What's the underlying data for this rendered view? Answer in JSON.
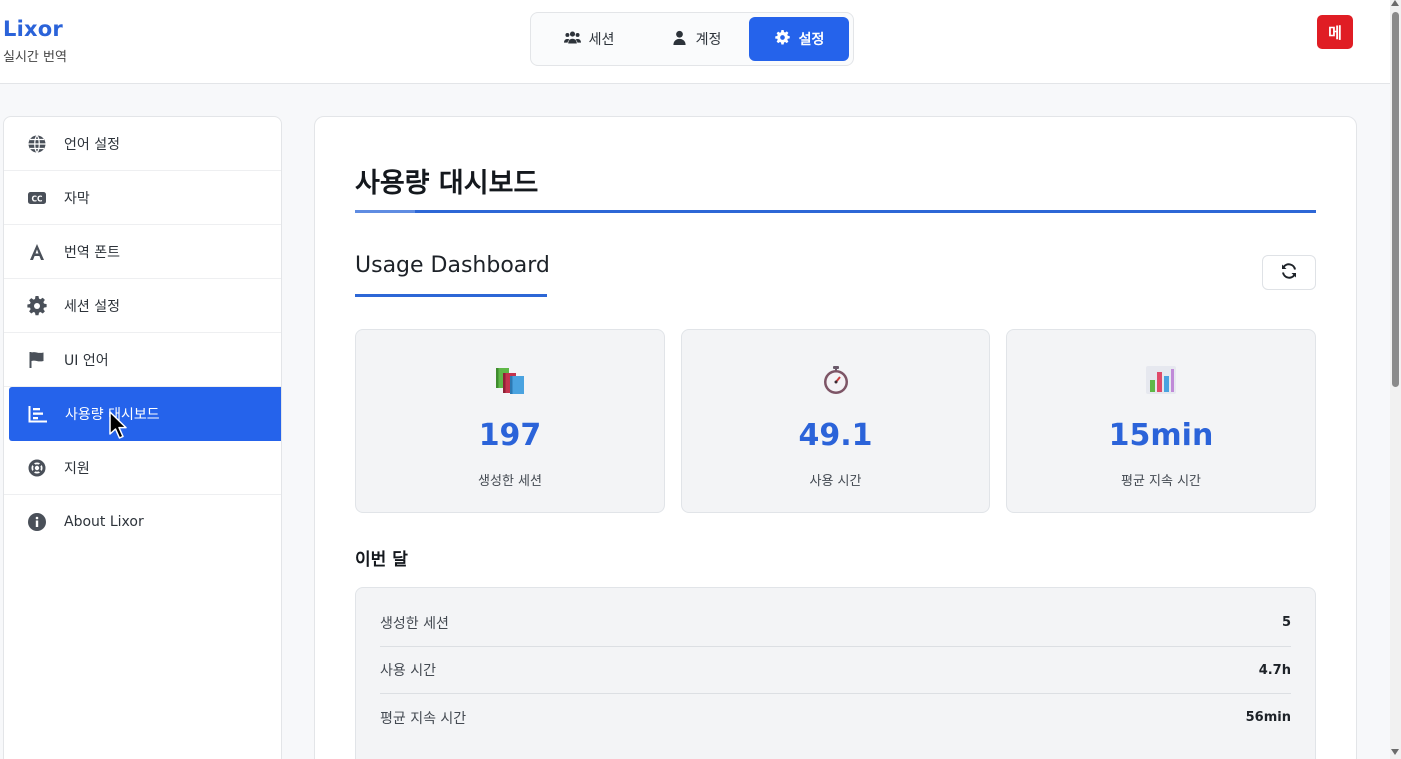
{
  "brand": {
    "name": "Lixor",
    "subtitle": "실시간 번역"
  },
  "top_nav": {
    "items": [
      {
        "label": "세션",
        "icon": "users-icon"
      },
      {
        "label": "계정",
        "icon": "user-icon"
      },
      {
        "label": "설정",
        "icon": "gear-icon",
        "active": true
      }
    ]
  },
  "menu_button": {
    "label": "메",
    "color": "#e01d24"
  },
  "sidebar": {
    "items": [
      {
        "label": "언어 설정",
        "icon": "globe-icon"
      },
      {
        "label": "자막",
        "icon": "closed-caption-icon"
      },
      {
        "label": "번역 폰트",
        "icon": "font-icon"
      },
      {
        "label": "세션 설정",
        "icon": "gear-icon"
      },
      {
        "label": "UI 언어",
        "icon": "flag-icon"
      },
      {
        "label": "사용량 대시보드",
        "icon": "bar-chart-icon",
        "active": true
      },
      {
        "label": "지원",
        "icon": "lifebuoy-icon"
      },
      {
        "label": "About Lixor",
        "icon": "info-icon"
      }
    ]
  },
  "main": {
    "title": "사용량 대시보드",
    "subtitle": "Usage Dashboard",
    "refresh_icon": "refresh-icon",
    "stats": [
      {
        "icon": "books-icon",
        "value": "197",
        "label": "생성한 세션"
      },
      {
        "icon": "stopwatch-icon",
        "value": "49.1",
        "label": "사용 시간"
      },
      {
        "icon": "bar-chart-emoji-icon",
        "value": "15min",
        "label": "평균 지속 시간"
      }
    ],
    "month": {
      "title": "이번 달",
      "rows": [
        {
          "label": "생성한 세션",
          "value": "5"
        },
        {
          "label": "사용 시간",
          "value": "4.7h"
        },
        {
          "label": "평균 지속 시간",
          "value": "56min"
        }
      ]
    }
  },
  "colors": {
    "accent": "#2563eb",
    "value_blue": "#2b63d9",
    "menu_red": "#e01d24"
  }
}
